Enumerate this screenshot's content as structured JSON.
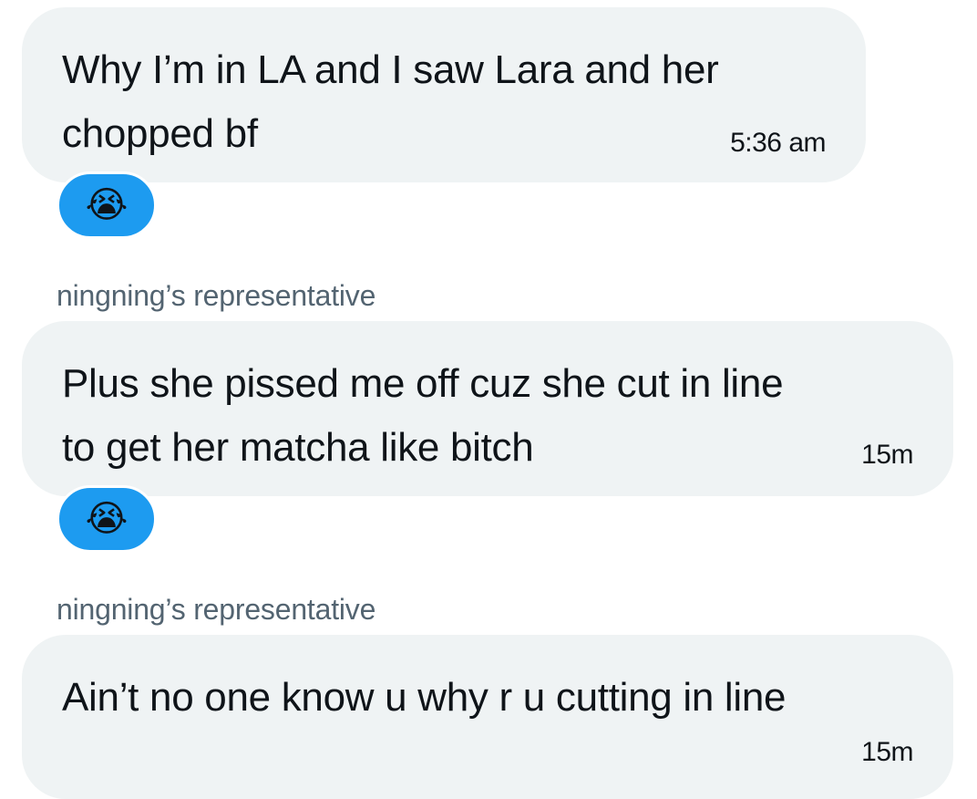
{
  "messages": [
    {
      "text": "Why I’m in LA and I saw Lara and her\nchopped bf",
      "time": "5:36 am",
      "reaction": "😭"
    },
    {
      "sender": "ningning’s representative",
      "text": "Plus she pissed me off cuz she cut in line\nto get her matcha like bitch",
      "time": "15m",
      "reaction": "😭"
    },
    {
      "sender": "ningning’s representative",
      "text": "Ain’t no one know u why r u cutting in line",
      "time": "15m"
    }
  ],
  "colors": {
    "bubble": "#eff3f4",
    "reaction": "#1d9bf0",
    "sender": "#536471",
    "text": "#0f1419"
  }
}
